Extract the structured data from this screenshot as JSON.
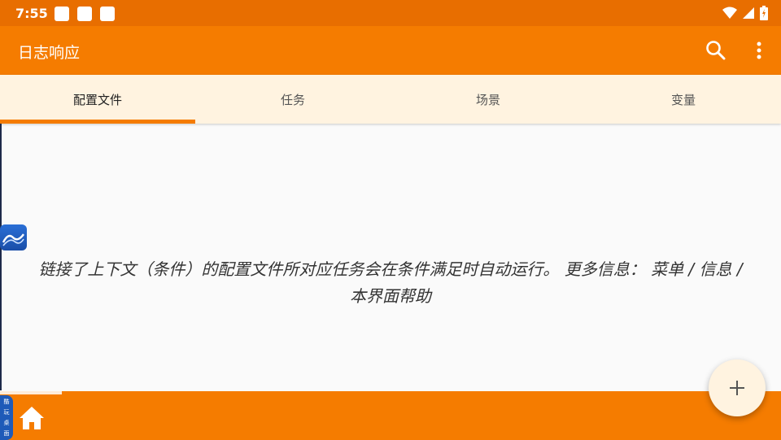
{
  "status_bar": {
    "time": "7:55",
    "icons": [
      "notification-icon",
      "notification-icon",
      "notification-icon",
      "wifi-icon",
      "signal-icon",
      "battery-icon"
    ]
  },
  "app_bar": {
    "title": "日志响应",
    "actions": [
      "search-icon",
      "more-vert-icon"
    ]
  },
  "tabs": [
    {
      "label": "配置文件",
      "active": true
    },
    {
      "label": "任务",
      "active": false
    },
    {
      "label": "场景",
      "active": false
    },
    {
      "label": "变量",
      "active": false
    }
  ],
  "main": {
    "empty_line1": "链接了上下文（条件）的配置文件所对应任务会在条件满足时自动运行。 更多信息： 菜单 / 信息 /",
    "empty_line2": "本界面帮助"
  },
  "side_pill": {
    "chars": [
      "酷",
      "玩",
      "桌",
      "面"
    ]
  },
  "fab": {
    "icon": "plus-icon"
  },
  "colors": {
    "status_bar": "#e86e00",
    "app_bar": "#f57c00",
    "tab_bar": "#fff3e0",
    "indicator": "#f57c00"
  }
}
